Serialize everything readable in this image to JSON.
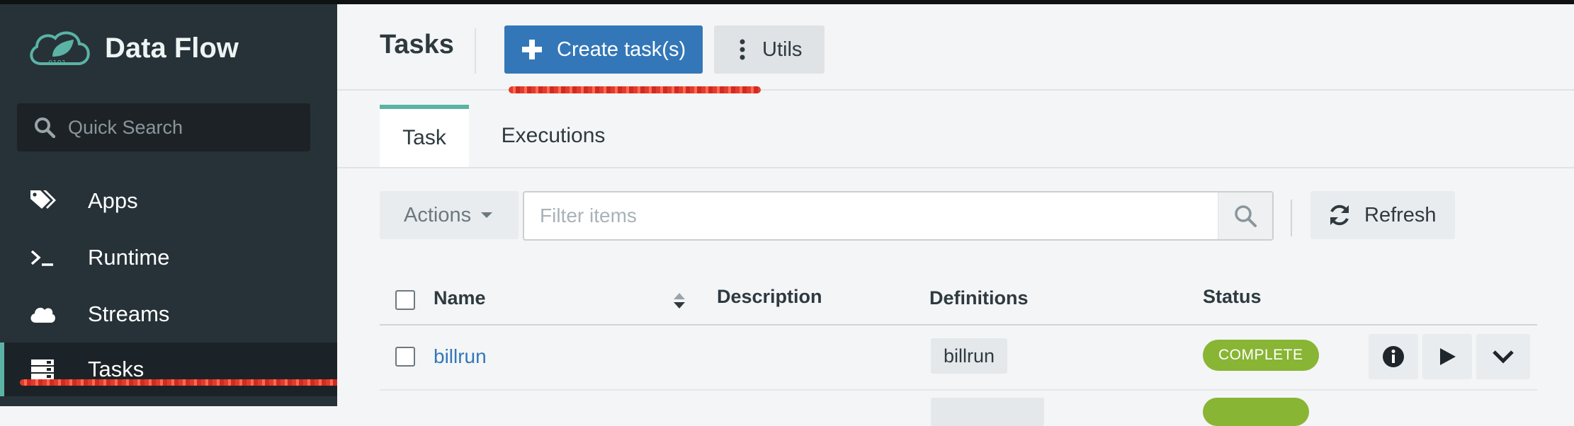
{
  "sidebar": {
    "brand": "Data Flow",
    "search_placeholder": "Quick Search",
    "items": [
      {
        "label": "Apps",
        "icon": "tags-icon"
      },
      {
        "label": "Runtime",
        "icon": "terminal-icon"
      },
      {
        "label": "Streams",
        "icon": "cloud-icon"
      },
      {
        "label": "Tasks",
        "icon": "server-icon",
        "active": true
      }
    ]
  },
  "header": {
    "title": "Tasks",
    "create_label": "Create task(s)",
    "utils_label": "Utils"
  },
  "tabs": [
    {
      "label": "Task",
      "active": true
    },
    {
      "label": "Executions"
    }
  ],
  "toolbar": {
    "actions_label": "Actions",
    "filter_placeholder": "Filter items",
    "refresh_label": "Refresh"
  },
  "table": {
    "columns": [
      "Name",
      "Description",
      "Definitions",
      "Status"
    ],
    "rows": [
      {
        "name": "billrun",
        "description": "",
        "definition": "billrun",
        "status": "COMPLETE"
      }
    ]
  },
  "colors": {
    "sidebar_bg": "#263238",
    "accent_teal": "#5bb3a5",
    "primary_blue": "#3377b8",
    "status_green": "#88b534",
    "annotation_red": "#e23b2e"
  }
}
